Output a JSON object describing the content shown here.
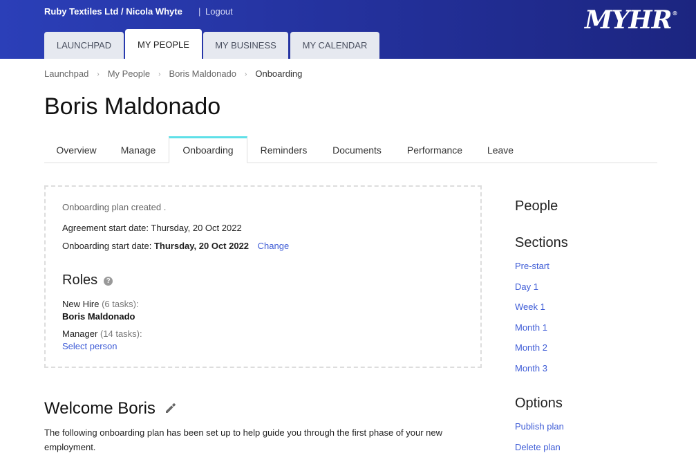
{
  "header": {
    "account": "Ruby Textiles Ltd / Nicola Whyte",
    "separator": "|",
    "logout": "Logout",
    "logo": "MYHR",
    "logo_mark": "®",
    "tabs": [
      {
        "label": "LAUNCHPAD",
        "active": false
      },
      {
        "label": "MY PEOPLE",
        "active": true
      },
      {
        "label": "MY BUSINESS",
        "active": false
      },
      {
        "label": "MY CALENDAR",
        "active": false
      }
    ]
  },
  "breadcrumb": [
    "Launchpad",
    "My People",
    "Boris Maldonado",
    "Onboarding"
  ],
  "page_title": "Boris Maldonado",
  "subtabs": [
    {
      "label": "Overview",
      "active": false
    },
    {
      "label": "Manage",
      "active": false
    },
    {
      "label": "Onboarding",
      "active": true
    },
    {
      "label": "Reminders",
      "active": false
    },
    {
      "label": "Documents",
      "active": false
    },
    {
      "label": "Performance",
      "active": false
    },
    {
      "label": "Leave",
      "active": false
    }
  ],
  "plan": {
    "created": "Onboarding plan created .",
    "agreement_label": "Agreement start date:",
    "agreement_value": "Thursday, 20 Oct 2022",
    "onboarding_label": "Onboarding start date:",
    "onboarding_value": "Thursday, 20 Oct 2022",
    "change": "Change",
    "roles_title": "Roles",
    "help_glyph": "?",
    "roles": [
      {
        "name": "New Hire",
        "tasks": "(6 tasks):",
        "person": "Boris Maldonado",
        "action": ""
      },
      {
        "name": "Manager",
        "tasks": "(14 tasks):",
        "person": "",
        "action": "Select person"
      }
    ]
  },
  "welcome": {
    "title": "Welcome Boris",
    "text": "The following onboarding plan has been set up to help guide you through the first phase of your new employment."
  },
  "sidebar": {
    "people_heading": "People",
    "sections_heading": "Sections",
    "sections": [
      "Pre-start",
      "Day 1",
      "Week 1",
      "Month 1",
      "Month 2",
      "Month 3"
    ],
    "options_heading": "Options",
    "options": [
      "Publish plan",
      "Delete plan"
    ]
  },
  "colors": {
    "header_start": "#2b3fb8",
    "header_end": "#1c2580",
    "link": "#3d5bd6",
    "active_tab_accent": "#5ee0e8"
  }
}
